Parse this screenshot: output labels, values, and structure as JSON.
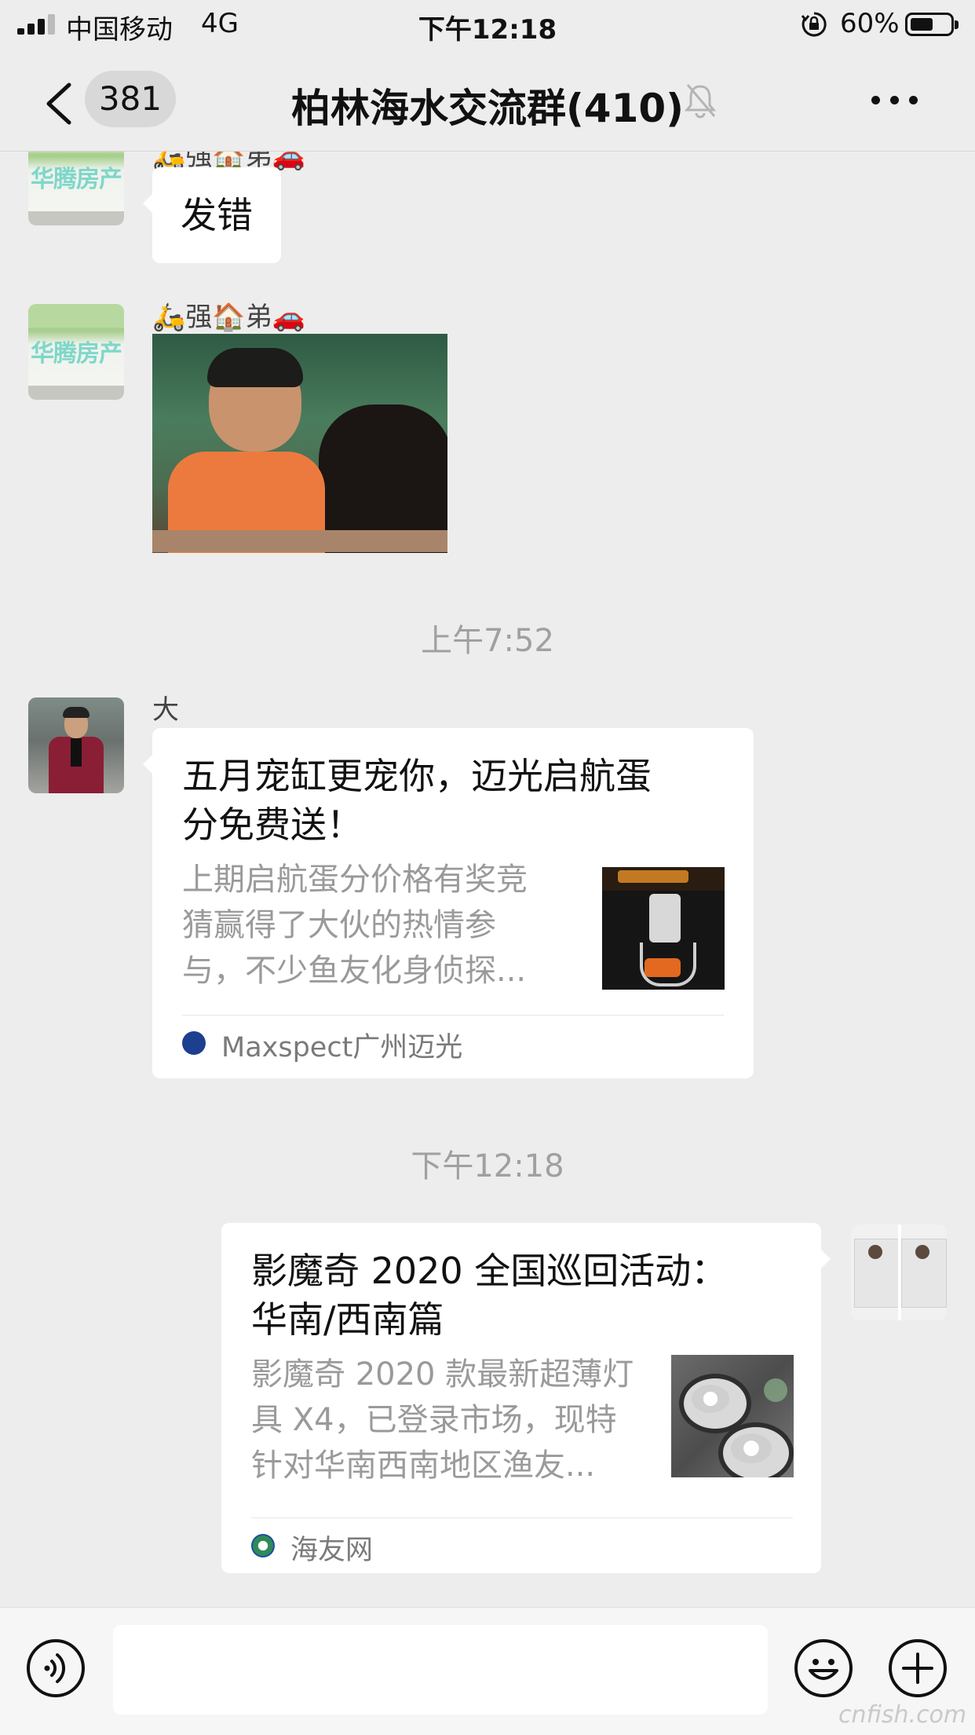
{
  "status_bar": {
    "carrier": "中国移动",
    "network": "4G",
    "time": "下午12:18",
    "battery": "60%"
  },
  "header": {
    "unread_count": "381",
    "title": "柏林海水交流群(410)"
  },
  "messages": {
    "m1": {
      "sender": "🛵强🏠弟🚗",
      "text": "发错"
    },
    "m2": {
      "sender": "🛵强🏠弟🚗",
      "avatar_text": "华腾房产"
    },
    "ts1": "上午7:52",
    "m3": {
      "sender": "大",
      "title_line1": "五月宠缸更宠你，迈光启航蛋",
      "title_line2": "分免费送！",
      "desc_line1": "上期启航蛋分价格有奖竞",
      "desc_line2": "猜赢得了大伙的热情参",
      "desc_line3": "与，不少鱼友化身侦探...",
      "source": "Maxspect广州迈光"
    },
    "ts2": "下午12:18",
    "m4": {
      "title_line1": "影魔奇 2020 全国巡回活动：",
      "title_line2": "华南/西南篇",
      "desc_line1": "影魔奇 2020 款最新超薄灯",
      "desc_line2": "具 X4，已登录市场，现特",
      "desc_line3": "针对华南西南地区渔友...",
      "source": "海友网"
    }
  },
  "watermark": "cnfish.com",
  "colors": {
    "background": "#ededed",
    "bubble": "#ffffff",
    "timestamp": "#a0a0a0",
    "maxspect_blue": "#1c3f8f",
    "haiyou_green": "#2e8b57"
  }
}
